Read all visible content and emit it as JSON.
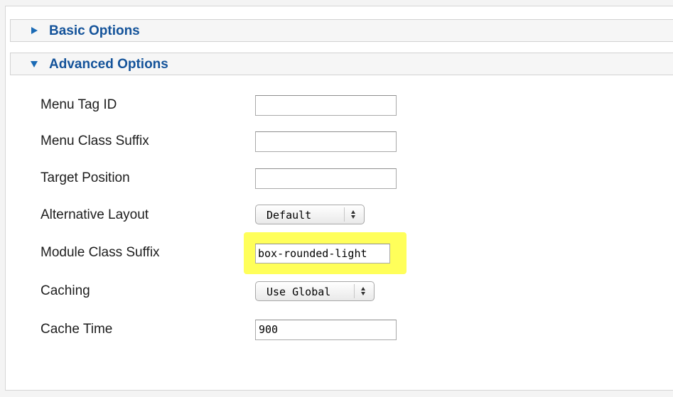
{
  "panels": {
    "basic": {
      "title": "Basic Options",
      "state": "collapsed"
    },
    "advanced": {
      "title": "Advanced Options",
      "state": "expanded"
    }
  },
  "fields": {
    "menu_tag_id": {
      "label": "Menu Tag ID",
      "value": ""
    },
    "menu_class_suffix": {
      "label": "Menu Class Suffix",
      "value": ""
    },
    "target_position": {
      "label": "Target Position",
      "value": ""
    },
    "alternative_layout": {
      "label": "Alternative Layout",
      "value": "Default"
    },
    "module_class_suffix": {
      "label": "Module Class Suffix",
      "value": "box-rounded-light"
    },
    "caching": {
      "label": "Caching",
      "value": "Use Global"
    },
    "cache_time": {
      "label": "Cache Time",
      "value": "900"
    }
  },
  "colors": {
    "header_title": "#14539a",
    "caret": "#1a6ab5",
    "highlight": "#ffff5a"
  },
  "icons": {
    "basic_caret": "triangle-right-icon",
    "advanced_caret": "triangle-down-icon",
    "select_arrows": "up-down-arrows-icon"
  }
}
